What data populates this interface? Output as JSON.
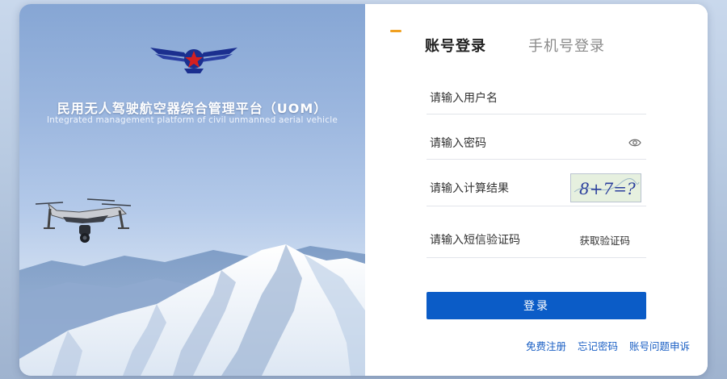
{
  "hero": {
    "title": "民用无人驾驶航空器综合管理平台（UOM）",
    "subtitle": "Integrated management platform of civil unmanned aerial vehicle",
    "logo_icon": "winged-star-emblem-icon",
    "drone_icon": "quadcopter-drone-icon"
  },
  "tabs": [
    {
      "label": "账号登录",
      "active": true
    },
    {
      "label": "手机号登录",
      "active": false
    }
  ],
  "form": {
    "username_placeholder": "请输入用户名",
    "password_placeholder": "请输入密码",
    "captcha_placeholder": "请输入计算结果",
    "captcha_text": "8+7=?",
    "sms_placeholder": "请输入短信验证码",
    "get_code_label": "获取验证码",
    "password_toggle_icon": "eye-icon"
  },
  "login_button": "登录",
  "links": {
    "register": "免费注册",
    "forgot": "忘记密码",
    "appeal": "账号问题申诉"
  },
  "colors": {
    "primary": "#0b5cc7",
    "tab_accent": "#f0a020",
    "link": "#1a5fc4"
  }
}
